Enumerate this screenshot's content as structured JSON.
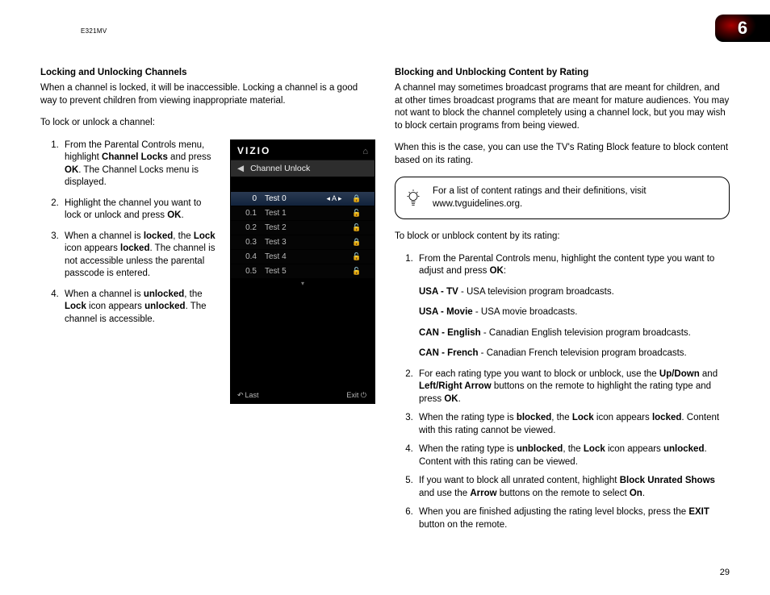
{
  "model": "E321MV",
  "chapter_number": "6",
  "page_number": "29",
  "left": {
    "heading": "Locking and Unlocking Channels",
    "intro": "When a channel is locked, it will be inaccessible. Locking a channel is a good way to prevent children from viewing inappropriate material.",
    "lead": "To lock or unlock a channel:",
    "steps": {
      "s1_a": "From the Parental Controls menu, highlight ",
      "s1_b": "Channel Locks",
      "s1_c": " and press ",
      "s1_d": "OK",
      "s1_e": ". The Channel Locks menu is displayed.",
      "s2_a": "Highlight the channel you want to lock or unlock and press ",
      "s2_b": "OK",
      "s2_c": ".",
      "s3_a": "When a channel is ",
      "s3_b": "locked",
      "s3_c": ", the ",
      "s3_d": "Lock",
      "s3_e": " icon appears ",
      "s3_f": "locked",
      "s3_g": ". The channel is not accessible unless the parental passcode is entered.",
      "s4_a": "When a channel is ",
      "s4_b": "unlocked",
      "s4_c": ", the ",
      "s4_d": "Lock",
      "s4_e": " icon appears ",
      "s4_f": "unlocked",
      "s4_g": ". The channel is accessible."
    }
  },
  "tv": {
    "brand": "VIZIO",
    "home_icon": "⌂",
    "back_arrow": "◀",
    "screen_title": "Channel Unlock",
    "footer_last": "Last",
    "footer_exit": "Exit",
    "more_icon": "▾",
    "rows": [
      {
        "num": "0",
        "name": "Test 0",
        "nav": "◂ A ▸",
        "lock": "🔒",
        "highlight": true
      },
      {
        "num": "0.1",
        "name": "Test 1",
        "nav": "",
        "lock": "🔓",
        "highlight": false
      },
      {
        "num": "0.2",
        "name": "Test 2",
        "nav": "",
        "lock": "🔓",
        "highlight": false
      },
      {
        "num": "0.3",
        "name": "Test 3",
        "nav": "",
        "lock": "🔒",
        "highlight": false
      },
      {
        "num": "0.4",
        "name": "Test 4",
        "nav": "",
        "lock": "🔓",
        "highlight": false
      },
      {
        "num": "0.5",
        "name": "Test 5",
        "nav": "",
        "lock": "🔓",
        "highlight": false
      }
    ]
  },
  "right": {
    "heading": "Blocking and Unblocking Content by Rating",
    "p1": "A channel may sometimes broadcast programs that are meant for children, and at other times broadcast programs that are meant for mature audiences. You may not want to block the channel completely using a channel lock, but you may wish to block certain programs from being viewed.",
    "p2": "When this is the case, you can use the TV's Rating Block feature to block content based on its rating.",
    "callout": "For a list of content ratings and their definitions, visit www.tvguidelines.org.",
    "lead": "To block or unblock content by its rating:",
    "steps": {
      "s1_a": "From the Parental Controls menu, highlight the content type you want to adjust and press ",
      "s1_b": "OK",
      "s1_c": ":",
      "ct1_a": "USA - TV",
      "ct1_b": " - USA television program broadcasts.",
      "ct2_a": "USA - Movie",
      "ct2_b": " - USA movie broadcasts.",
      "ct3_a": "CAN - English",
      "ct3_b": " - Canadian English television program broadcasts.",
      "ct4_a": "CAN - French",
      "ct4_b": " - Canadian French television program broadcasts.",
      "s2_a": "For each rating type you want to block or unblock, use the ",
      "s2_b": "Up/Down",
      "s2_c": " and ",
      "s2_d": "Left/Right Arrow",
      "s2_e": " buttons on the remote to highlight the rating type and press ",
      "s2_f": "OK",
      "s2_g": ".",
      "s3_a": "When the rating type is ",
      "s3_b": "blocked",
      "s3_c": ", the ",
      "s3_d": "Lock",
      "s3_e": " icon appears ",
      "s3_f": "locked",
      "s3_g": ". Content with this rating cannot be viewed.",
      "s4_a": "When the rating type is ",
      "s4_b": "unblocked",
      "s4_c": ", the ",
      "s4_d": "Lock",
      "s4_e": " icon appears ",
      "s4_f": "unlocked",
      "s4_g": ". Content with this rating can be viewed.",
      "s5_a": "If you want to block all unrated content, highlight ",
      "s5_b": "Block Unrated Shows",
      "s5_c": " and use the ",
      "s5_d": "Arrow",
      "s5_e": " buttons on the remote to select ",
      "s5_f": "On",
      "s5_g": ".",
      "s6_a": "When you are finished adjusting the rating level blocks, press the ",
      "s6_b": "EXIT",
      "s6_c": " button on the remote."
    }
  }
}
